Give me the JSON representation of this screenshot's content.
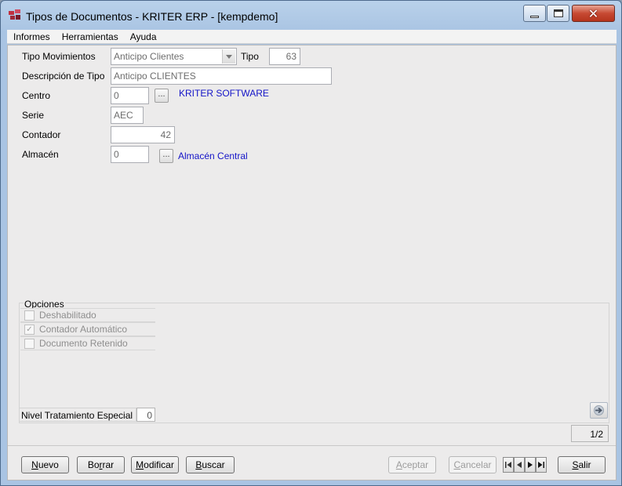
{
  "window": {
    "title": "Tipos de Documentos - KRITER ERP - [kempdemo]"
  },
  "menu": [
    "Informes",
    "Herramientas",
    "Ayuda"
  ],
  "form": {
    "tipo_movimientos": {
      "label": "Tipo Movimientos",
      "value": "Anticipo Clientes"
    },
    "tipo": {
      "label": "Tipo",
      "value": "63"
    },
    "descripcion": {
      "label": "Descripción de Tipo",
      "value": "Anticipo CLIENTES"
    },
    "centro": {
      "label": "Centro",
      "value": "0",
      "lookup_button": "...",
      "name": "KRITER SOFTWARE"
    },
    "serie": {
      "label": "Serie",
      "value": "AEC"
    },
    "contador": {
      "label": "Contador",
      "value": "42"
    },
    "almacen": {
      "label": "Almacén",
      "value": "0",
      "lookup_button": "...",
      "name": "Almacén Central"
    }
  },
  "options": {
    "title": "Opciones",
    "items": [
      {
        "label": "Deshabilitado",
        "checked": false
      },
      {
        "label": "Contador Automático",
        "checked": true
      },
      {
        "label": "Documento Retenido",
        "checked": false
      }
    ],
    "nivel": {
      "label": "Nivel Tratamiento Especial",
      "value": "0"
    }
  },
  "page_indicator": "1/2",
  "buttons": {
    "nuevo": {
      "pre": "",
      "key": "N",
      "post": "uevo"
    },
    "borrar": {
      "pre": "Bo",
      "key": "r",
      "post": "rar"
    },
    "modificar": {
      "pre": "",
      "key": "M",
      "post": "odificar"
    },
    "buscar": {
      "pre": "",
      "key": "B",
      "post": "uscar"
    },
    "aceptar": {
      "pre": "",
      "key": "A",
      "post": "ceptar"
    },
    "cancelar": {
      "pre": "",
      "key": "C",
      "post": "ancelar"
    },
    "salir": {
      "pre": "",
      "key": "S",
      "post": "alir"
    }
  },
  "icons": {
    "check": "✓",
    "close": "✕",
    "next_arrow": "next-arrow-icon"
  }
}
